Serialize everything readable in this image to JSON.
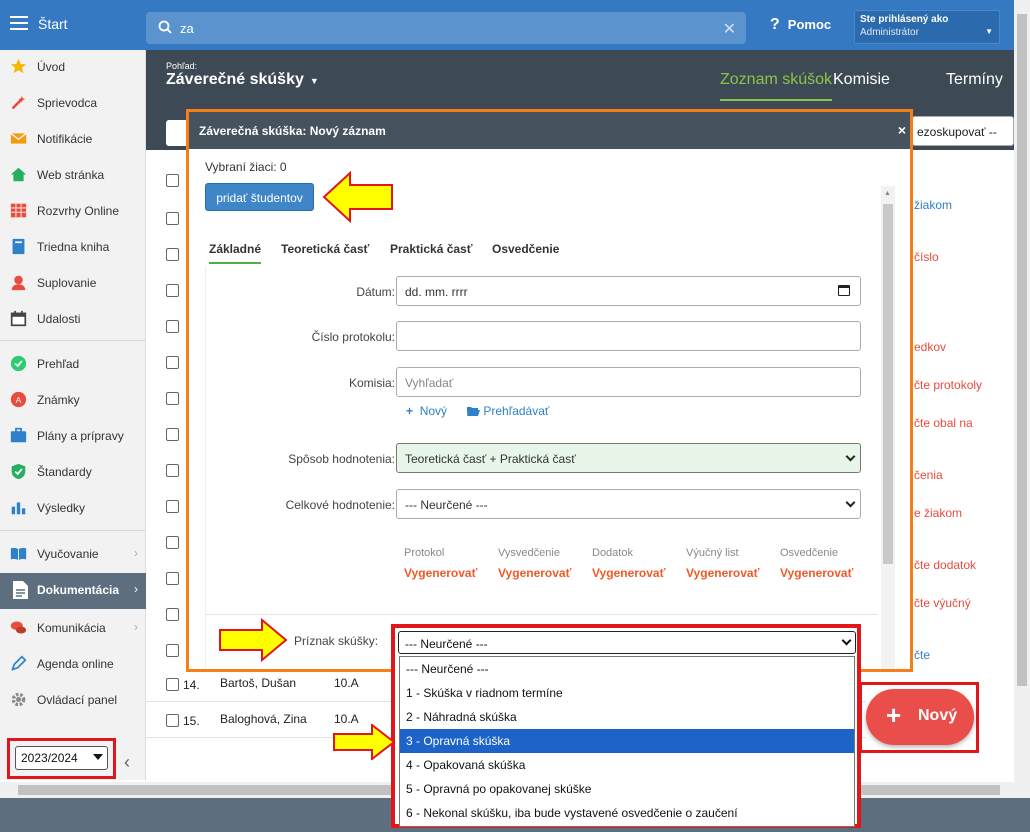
{
  "topbar": {
    "start_label": "Štart",
    "search_value": "za",
    "help_label": "Pomoc",
    "user_line1": "Ste prihlásený ako",
    "user_line2": "Administrátor"
  },
  "sidebar": {
    "items": [
      {
        "label": "Úvod",
        "icon": "star-icon"
      },
      {
        "label": "Sprievodca",
        "icon": "wand-icon"
      },
      {
        "label": "Notifikácie",
        "icon": "envelope-icon"
      },
      {
        "label": "Web stránka",
        "icon": "home-icon"
      },
      {
        "label": "Rozvrhy Online",
        "icon": "calendar-grid-icon"
      },
      {
        "label": "Triedna kniha",
        "icon": "book-icon"
      },
      {
        "label": "Suplovanie",
        "icon": "person-icon"
      },
      {
        "label": "Udalosti",
        "icon": "calendar-icon"
      },
      {
        "label": "Prehľad",
        "icon": "check-circle-icon"
      },
      {
        "label": "Známky",
        "icon": "grade-icon"
      },
      {
        "label": "Plány a prípravy",
        "icon": "briefcase-icon"
      },
      {
        "label": "Štandardy",
        "icon": "shield-check-icon"
      },
      {
        "label": "Výsledky",
        "icon": "bar-chart-icon"
      },
      {
        "label": "Vyučovanie",
        "icon": "open-book-icon"
      },
      {
        "label": "Dokumentácia",
        "icon": "document-icon"
      },
      {
        "label": "Komunikácia",
        "icon": "chat-icon"
      },
      {
        "label": "Agenda online",
        "icon": "pen-icon"
      },
      {
        "label": "Ovládací panel",
        "icon": "gear-icon"
      }
    ],
    "year_value": "2023/2024",
    "collapse_glyph": "‹"
  },
  "header": {
    "pohlad_label": "Pohľad:",
    "view_title": "Záverečné skúšky",
    "tabs": [
      "Zoznam skúšok",
      "Komisie",
      "Termíny"
    ],
    "filter_right_value": "ezoskupovať --"
  },
  "table": {
    "rows": [
      {
        "num": "14.",
        "name": "Bartoš, Dušan",
        "class": "10.A"
      },
      {
        "num": "15.",
        "name": "Baloghová, Zina",
        "class": "10.A"
      }
    ],
    "right_links": [
      "žiakom",
      "číslo",
      "edkov",
      "čte protokoly",
      "čte obal na",
      "čenia",
      "e žiakom",
      "čte dodatok",
      "čte výučný",
      "čte"
    ]
  },
  "modal": {
    "title": "Záverečná skúška: Nový záznam",
    "close": "×",
    "selected_students": "Vybraní žiaci: 0",
    "add_students_button": "pridať študentov",
    "tabs": [
      "Základné",
      "Teoretická časť",
      "Praktická časť",
      "Osvedčenie"
    ],
    "fields": {
      "datum_label": "Dátum:",
      "datum_value": "dd. mm. rrrr",
      "protokol_label": "Číslo protokolu:",
      "komisia_label": "Komisia:",
      "komisia_placeholder": "Vyhľadať",
      "novy_link": "Nový",
      "prehladavat_link": "Prehľadávať",
      "sposob_label": "Spôsob hodnotenia:",
      "sposob_value": "Teoretická časť + Praktická časť",
      "celkove_label": "Celkové hodnotenie:",
      "celkove_value": "--- Neurčené ---"
    },
    "generate": {
      "labels": [
        "Protokol",
        "Vysvedčenie",
        "Dodatok",
        "Výučný list",
        "Osvedčenie"
      ],
      "link": "Vygenerovať"
    },
    "priznak_label": "Príznak skúšky:"
  },
  "priznak_dropdown": {
    "selected": "--- Neurčené ---",
    "options": [
      "--- Neurčené ---",
      "1 - Skúška v riadnom termíne",
      "2 - Náhradná skúška",
      "3 - Opravná skúška",
      "4 - Opakovaná skúška",
      "5 - Opravná po opakovanej skúške",
      "6 - Nekonal skúšku, iba bude vystavené osvedčenie o zaučení"
    ],
    "highlighted_index": 3
  },
  "fab": {
    "label": "Nový",
    "plus": "+"
  },
  "colors": {
    "accent": "#3579c2",
    "header_dark": "#3d4a55",
    "active_tab": "#8ec24a",
    "generate": "#f05a28",
    "highlight_red": "#e0161b",
    "modal_border": "#f57f17",
    "arrow_yellow": "#ffff00"
  }
}
